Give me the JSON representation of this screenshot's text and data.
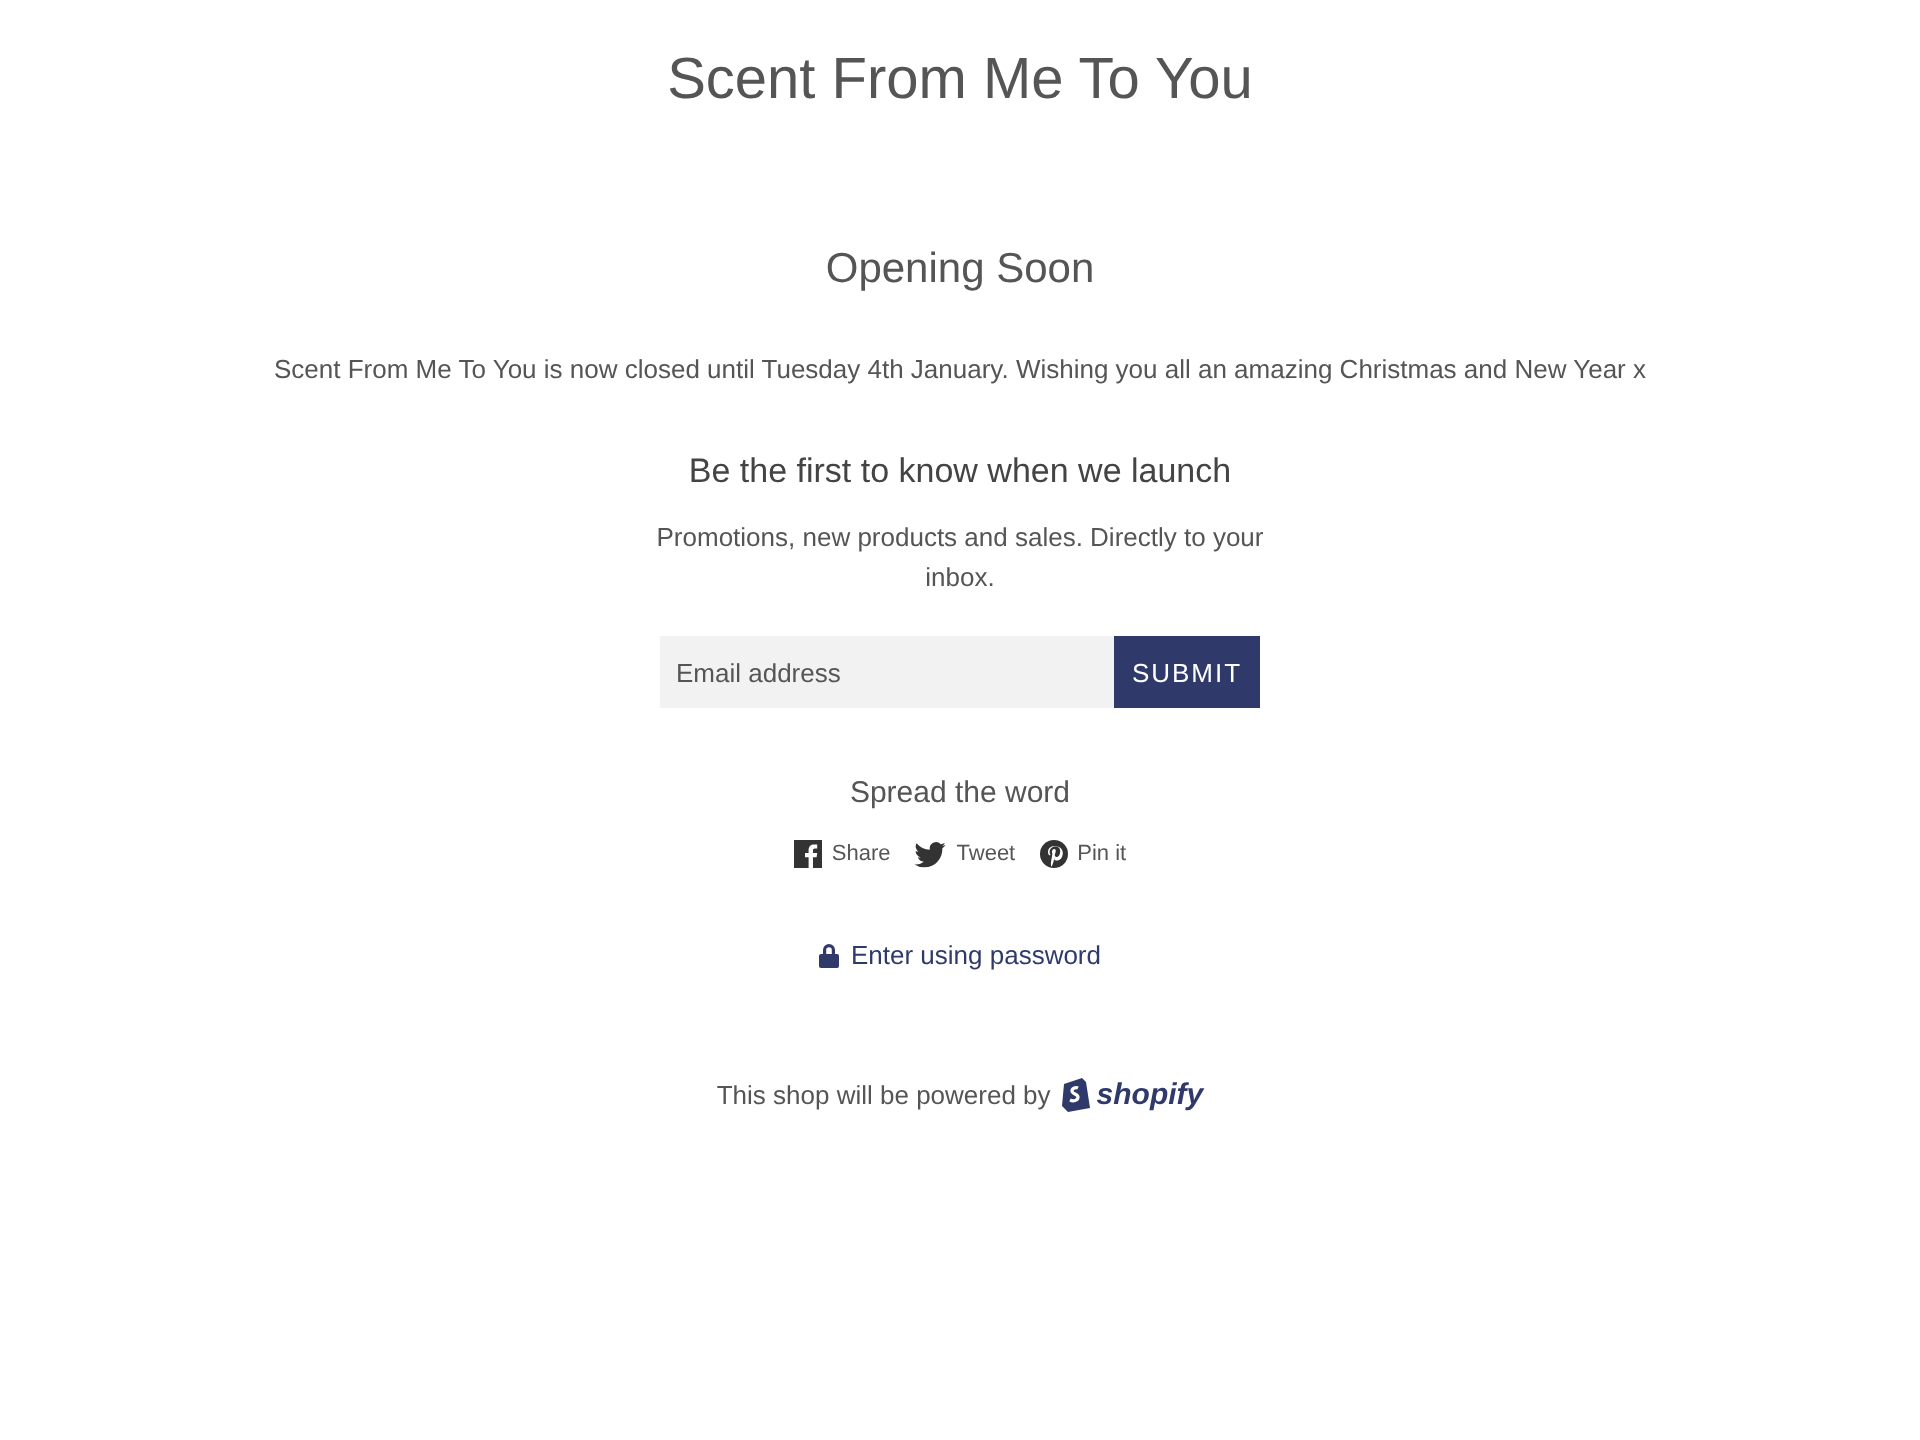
{
  "header": {
    "title": "Scent From Me To You"
  },
  "content": {
    "heading": "Opening Soon",
    "message": "Scent From Me To You is now closed until Tuesday 4th January. Wishing you all an amazing Christmas and New Year x"
  },
  "newsletter": {
    "heading": "Be the first to know when we launch",
    "text": "Promotions, new products and sales. Directly to your inbox.",
    "placeholder": "Email address",
    "button": "SUBMIT"
  },
  "share": {
    "heading": "Spread the word",
    "links": [
      {
        "kind": "facebook",
        "label": "Share"
      },
      {
        "kind": "twitter",
        "label": "Tweet"
      },
      {
        "kind": "pinterest",
        "label": "Pin it"
      }
    ]
  },
  "password_link": "Enter using password",
  "footer": {
    "text": "This shop will be powered by",
    "logo": "shopify"
  }
}
